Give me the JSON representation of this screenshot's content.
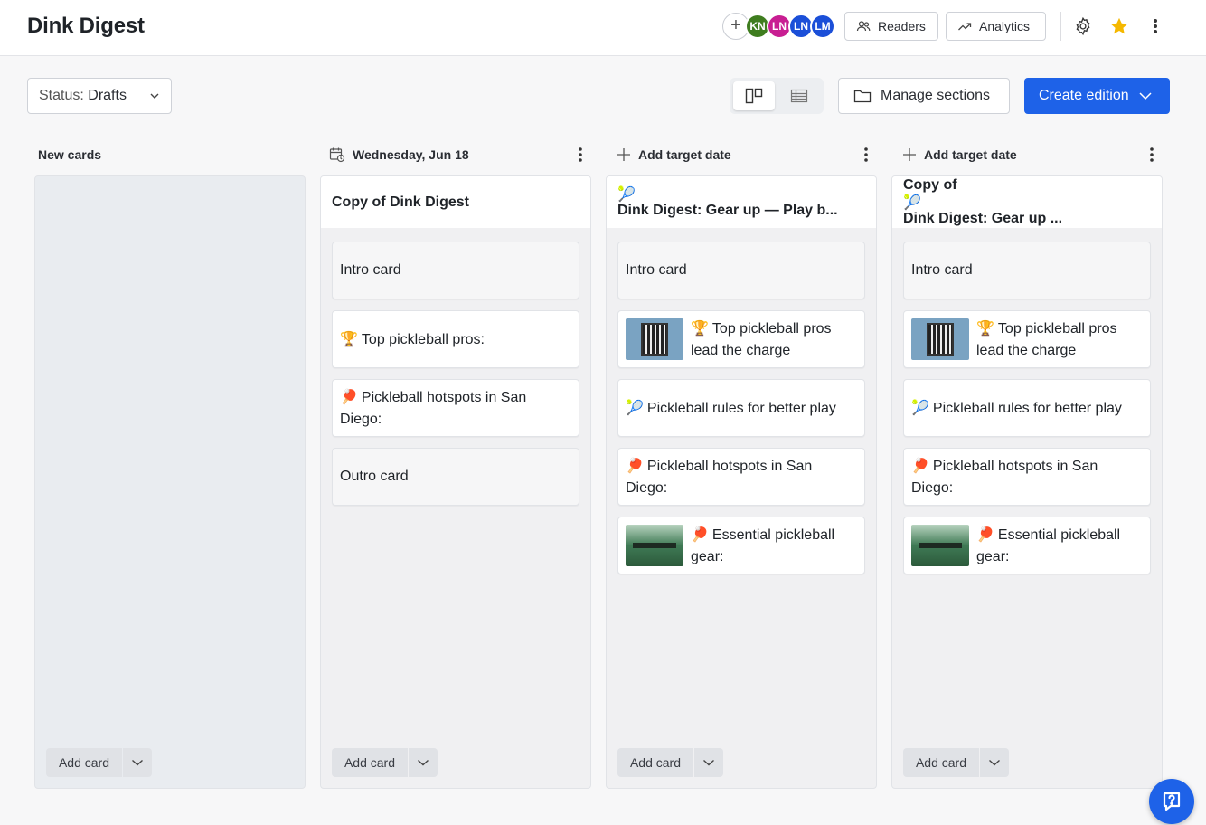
{
  "app": {
    "title": "Dink Digest"
  },
  "header": {
    "avatars": [
      {
        "initials": "KN",
        "color": "#3f7d1f"
      },
      {
        "initials": "LN",
        "color": "#c81e92"
      },
      {
        "initials": "LN",
        "color": "#1b4fd8"
      },
      {
        "initials": "LM",
        "color": "#1b4fd8"
      }
    ],
    "readers_label": "Readers",
    "analytics_label": "Analytics"
  },
  "toolbar": {
    "status_label": "Status:",
    "status_value": "Drafts",
    "manage_label": "Manage sections",
    "create_label": "Create edition"
  },
  "columns": [
    {
      "header": "New cards",
      "title": "",
      "cards": [],
      "add_label": "Add card"
    },
    {
      "header": "Wednesday, Jun 18",
      "title": "Copy of Dink Digest",
      "cards": [
        {
          "emoji": "",
          "text": "Intro card",
          "thumb": ""
        },
        {
          "emoji": "🏆",
          "text": "Top pickleball pros:",
          "thumb": ""
        },
        {
          "emoji": "🏓",
          "text": "Pickleball hotspots in San Diego:",
          "thumb": ""
        },
        {
          "emoji": "",
          "text": "Outro card",
          "thumb": ""
        }
      ],
      "add_label": "Add card"
    },
    {
      "header": "Add target date",
      "title_emoji": "🎾",
      "title": "Dink Digest: Gear up — Play b...",
      "cards": [
        {
          "emoji": "",
          "text": "Intro card",
          "thumb": ""
        },
        {
          "emoji": "🏆",
          "text": "Top pickleball pros lead the charge",
          "thumb": "qr"
        },
        {
          "emoji": "🎾",
          "text": "Pickleball rules for better play",
          "thumb": ""
        },
        {
          "emoji": "🏓",
          "text": "Pickleball hotspots in San Diego:",
          "thumb": ""
        },
        {
          "emoji": "🏓",
          "text": "Essential pickleball gear:",
          "thumb": "court"
        }
      ],
      "add_label": "Add card"
    },
    {
      "header": "Add target date",
      "title_prefix": "Copy of",
      "title_emoji": "🎾",
      "title": "Dink Digest: Gear up ...",
      "cards": [
        {
          "emoji": "",
          "text": "Intro card",
          "thumb": ""
        },
        {
          "emoji": "🏆",
          "text": "Top pickleball pros lead the charge",
          "thumb": "qr"
        },
        {
          "emoji": "🎾",
          "text": "Pickleball rules for better play",
          "thumb": ""
        },
        {
          "emoji": "🏓",
          "text": "Pickleball hotspots in San Diego:",
          "thumb": ""
        },
        {
          "emoji": "🏓",
          "text": "Essential pickleball gear:",
          "thumb": "court"
        }
      ],
      "add_label": "Add card"
    }
  ],
  "colors": {
    "accent": "#1e62e8",
    "star": "#f5b800"
  }
}
